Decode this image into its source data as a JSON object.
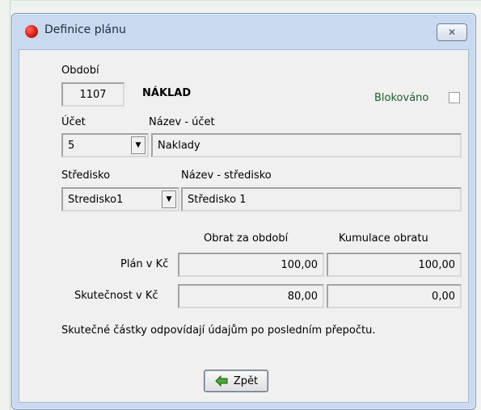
{
  "window": {
    "title": "Definice plánu",
    "close_symbol": "✕"
  },
  "form": {
    "period_label": "Období",
    "period_value": "1107",
    "type_value": "NÁKLAD",
    "blocked_label": "Blokováno",
    "blocked_checked": false,
    "account_label": "Účet",
    "account_name_label": "Název - účet",
    "account_value": "5",
    "account_name_value": "Naklady",
    "center_label": "Středisko",
    "center_name_label": "Název - středisko",
    "center_value": "Stredisko1",
    "center_name_value": "Středisko 1"
  },
  "table": {
    "col_period": "Obrat za období",
    "col_cumulative": "Kumulace obratu",
    "rows": [
      {
        "label": "Plán v Kč",
        "period": "100,00",
        "cumulative": "100,00"
      },
      {
        "label": "Skutečnost v Kč",
        "period": "80,00",
        "cumulative": "0,00"
      }
    ]
  },
  "note": "Skutečné částky odpovídají údajům po posledním přepočtu.",
  "buttons": {
    "back_label": "Zpět"
  },
  "icons": {
    "title": "red-dot-icon",
    "close": "close-icon",
    "dropdown": "chevron-down-icon",
    "back": "green-arrow-icon"
  }
}
